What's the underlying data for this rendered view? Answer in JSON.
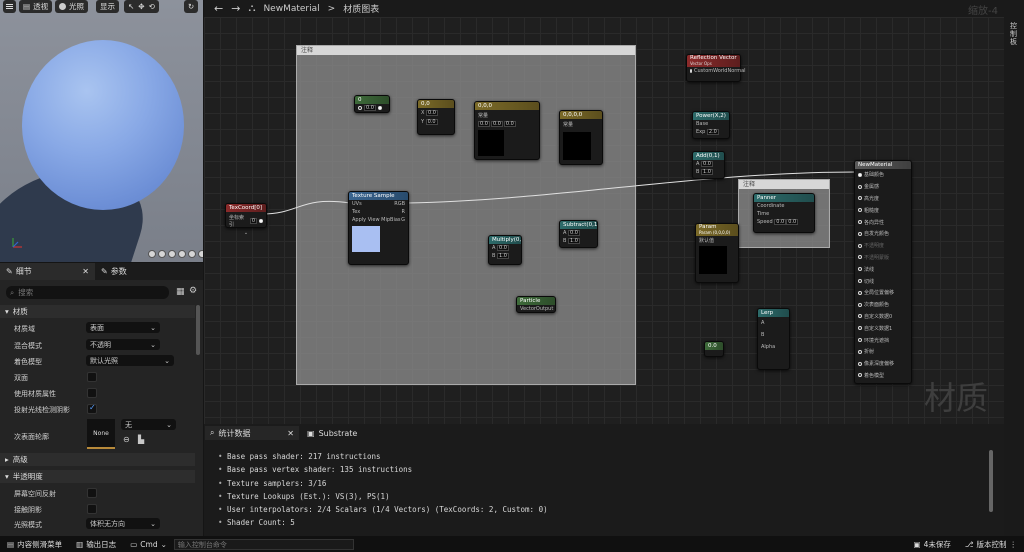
{
  "viewport": {
    "buttons": {
      "perspective": "透视",
      "lit": "光照",
      "show": "显示"
    }
  },
  "graph_toolbar": {
    "asset_name": "NewMaterial",
    "separator": ">",
    "graph_label": "材质图表",
    "zoom_label": "缩放-4"
  },
  "right_strip": {
    "label": "控制板"
  },
  "details_panel": {
    "tabs": [
      {
        "label": "细节"
      },
      {
        "label": "参数"
      }
    ],
    "search_placeholder": "搜索",
    "sections": {
      "material": "材质",
      "advanced": "高级",
      "translucency": "半透明度"
    },
    "properties": [
      {
        "label": "材质域",
        "value": "表面"
      },
      {
        "label": "混合模式",
        "value": "不透明"
      },
      {
        "label": "着色模型",
        "value": "默认光照"
      },
      {
        "label": "双面"
      },
      {
        "label": "使用材质属性"
      },
      {
        "label": "投射光线检测阴影"
      },
      {
        "label": "次表面轮廓",
        "thumb": "None",
        "value": "无"
      }
    ],
    "translucency_props": [
      {
        "label": "屏幕空间反射"
      },
      {
        "label": "接触阴影"
      },
      {
        "label": "光照模式",
        "value": "体积无方向"
      }
    ]
  },
  "graph": {
    "watermark": "材质",
    "comments": [
      {
        "label": "注释"
      },
      {
        "label": "注释"
      }
    ],
    "nodes": {
      "texcoord": {
        "title": "TexCoord[0]",
        "label": "坐标索引",
        "value": "0"
      },
      "texture_sample": {
        "title": "Texture Sample",
        "inputs": [
          "UVs",
          "Tex",
          "Apply View MipBias"
        ],
        "outputs": [
          "RGB",
          "R",
          "G",
          "B",
          "A",
          "RGBA"
        ]
      },
      "reflection": {
        "title": "Reflection Vector",
        "subtitle": "Vector Ops",
        "row": "CustomWorldNormal"
      },
      "panner": {
        "title": "Panner",
        "rows": [
          "Coordinate",
          "Time",
          "Speed"
        ],
        "speed_x": "0.0",
        "speed_y": "0.0"
      },
      "param": {
        "title": "Param",
        "subtitle": "Param (0,0,0,0)",
        "label": "默认值"
      },
      "result": {
        "title": "NewMaterial",
        "rows": [
          "基础颜色",
          "金属感",
          "高光度",
          "粗糙度",
          "各向异性",
          "自发光颜色",
          "不透明度",
          "不透明蒙版",
          "法线",
          "切线",
          "全局位置偏移",
          "次表面颜色",
          "自定义数据0",
          "自定义数据1",
          "环境光遮挡",
          "折射",
          "像素深度偏移",
          "着色模型"
        ]
      },
      "lerp": {
        "title": "Lerp",
        "rows": [
          "A",
          "B",
          "Alpha"
        ]
      },
      "power": {
        "title": "Power(X,2)",
        "rows": [
          "Base",
          "Exp"
        ],
        "exp": "2.0"
      },
      "multiply": {
        "title": "Multiply(0,1)",
        "a": "0.0",
        "b": "1.0"
      },
      "add": {
        "title": "Add(0,1)",
        "a": "0.0",
        "b": "1.0"
      },
      "scalar": {
        "title": "0",
        "value": "0.0"
      },
      "vec2": {
        "title": "0,0",
        "x": "0.0",
        "y": "0.0"
      },
      "vec3": {
        "title": "0,0,0",
        "label": "常量",
        "r": "0.0",
        "g": "0.0",
        "b": "0.0"
      },
      "vec4": {
        "title": "0,0,0,0",
        "label": "常量"
      },
      "subtract": {
        "title": "Subtract(0,1)",
        "a": "0.0",
        "b": "1.0"
      },
      "particle": {
        "title": "Particle",
        "row": "VectorOutput"
      },
      "small": {
        "title": "0.0"
      }
    }
  },
  "bottom_panel": {
    "tabs": [
      {
        "label": "统计数据"
      },
      {
        "label": "Substrate"
      }
    ],
    "stats": [
      "Base pass shader: 217 instructions",
      "Base pass vertex shader: 135 instructions",
      "Texture samplers: 3/16",
      "Texture Lookups (Est.): VS(3), PS(1)",
      "User interpolators: 2/4 Scalars (1/4 Vectors) (TexCoords: 2, Custom: 0)",
      "Shader Count: 5"
    ]
  },
  "status_bar": {
    "content_drawer": "内容侧滑菜单",
    "output_log": "输出日志",
    "cmd": "Cmd",
    "cmd_placeholder": "输入控制台命令",
    "unsaved": "4未保存",
    "source_control": "版本控制"
  }
}
